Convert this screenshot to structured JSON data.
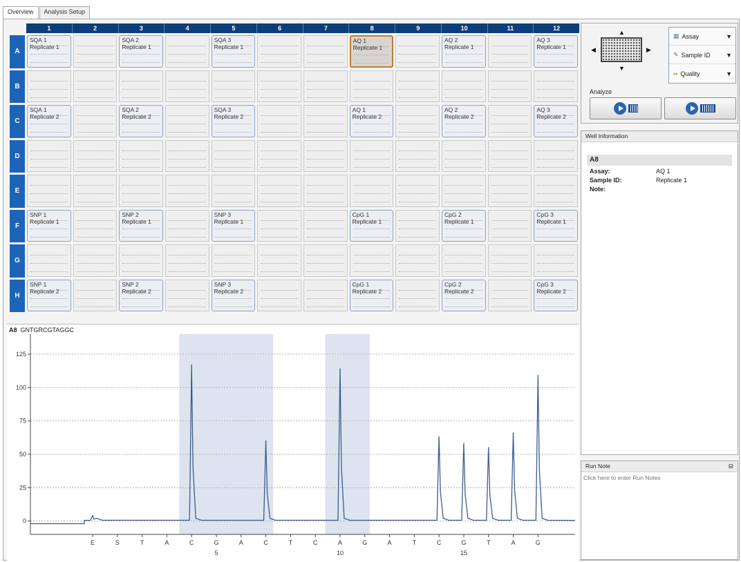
{
  "tabs": [
    {
      "label": "Overview"
    },
    {
      "label": "Analysis Setup"
    }
  ],
  "plate": {
    "columns": [
      "1",
      "2",
      "3",
      "4",
      "5",
      "6",
      "7",
      "8",
      "9",
      "10",
      "11",
      "12"
    ],
    "rows": [
      "A",
      "B",
      "C",
      "D",
      "E",
      "F",
      "G",
      "H"
    ],
    "selected_well": "A8",
    "wells": {
      "A1": [
        "SQA 1",
        "Replicate 1"
      ],
      "A3": [
        "SQA 2",
        "Replicate 1"
      ],
      "A5": [
        "SQA 3",
        "Replicate 1"
      ],
      "A8": [
        "AQ 1",
        "Replicate 1"
      ],
      "A10": [
        "AQ 2",
        "Replicate 1"
      ],
      "A12": [
        "AQ 3",
        "Replicate 1"
      ],
      "C1": [
        "SQA 1",
        "Replicate 2"
      ],
      "C3": [
        "SQA 2",
        "Replicate 2"
      ],
      "C5": [
        "SQA 3",
        "Replicate 2"
      ],
      "C8": [
        "AQ 1",
        "Replicate 2"
      ],
      "C10": [
        "AQ 2",
        "Replicate 2"
      ],
      "C12": [
        "AQ 3",
        "Replicate 2"
      ],
      "F1": [
        "SNP 1",
        "Replicate 1"
      ],
      "F3": [
        "SNP 2",
        "Replicate 1"
      ],
      "F5": [
        "SNP 3",
        "Replicate 1"
      ],
      "F8": [
        "CpG 1",
        "Replicate 1"
      ],
      "F10": [
        "CpG 2",
        "Replicate 1"
      ],
      "F12": [
        "CpG 3",
        "Replicate 1"
      ],
      "H1": [
        "SNP 1",
        "Replicate 2"
      ],
      "H3": [
        "SNP 2",
        "Replicate 2"
      ],
      "H5": [
        "SNP 3",
        "Replicate 2"
      ],
      "H8": [
        "CpG 1",
        "Replicate 2"
      ],
      "H10": [
        "CpG 2",
        "Replicate 2"
      ],
      "H12": [
        "CpG 3",
        "Replicate 2"
      ]
    }
  },
  "pyrogram": {
    "well": "A8",
    "sequence": "GNTGRCGTAGGC"
  },
  "chart_data": {
    "type": "line",
    "title": "",
    "ylim": [
      -10,
      140
    ],
    "yticks": [
      0,
      25,
      50,
      75,
      100,
      125
    ],
    "dispensations": [
      "E",
      "S",
      "T",
      "A",
      "C",
      "G",
      "A",
      "C",
      "T",
      "C",
      "A",
      "G",
      "A",
      "T",
      "C",
      "G",
      "T",
      "A",
      "G"
    ],
    "dispensation_numbers": [
      {
        "index": 6,
        "label": "5"
      },
      {
        "index": 11,
        "label": "10"
      },
      {
        "index": 16,
        "label": "15"
      }
    ],
    "peaks": [
      {
        "disp": 1,
        "height": 4
      },
      {
        "disp": 5,
        "height": 117
      },
      {
        "disp": 8,
        "height": 60
      },
      {
        "disp": 11,
        "height": 114
      },
      {
        "disp": 15,
        "height": 63
      },
      {
        "disp": 16,
        "height": 58
      },
      {
        "disp": 17,
        "height": 55
      },
      {
        "disp": 18,
        "height": 66
      },
      {
        "disp": 19,
        "height": 109
      }
    ],
    "shaded_ranges": [
      [
        4.5,
        8.3
      ],
      [
        10.4,
        12.2
      ]
    ],
    "grid": true,
    "line_color": "#3b5c8f",
    "shade_color": "#dde4ef"
  },
  "controls": {
    "selectors": [
      {
        "label": "Assay"
      },
      {
        "label": "Sample ID"
      },
      {
        "label": "Quality"
      }
    ],
    "analyze_label": "Analyze"
  },
  "well_info": {
    "header": "Well Information",
    "well": "A8",
    "fields": [
      {
        "key": "Assay:",
        "value": "AQ 1"
      },
      {
        "key": "Sample ID:",
        "value": "Replicate 1"
      },
      {
        "key": "Note:",
        "value": ""
      }
    ]
  },
  "run_note": {
    "header": "Run Note",
    "placeholder": "Click here to enter Run Notes"
  }
}
